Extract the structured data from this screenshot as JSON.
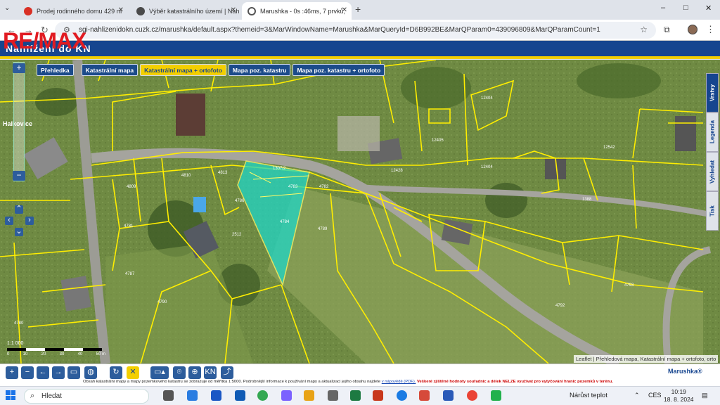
{
  "browser": {
    "tabs": [
      {
        "label": "Prodej rodinného domu 429 m",
        "favicon_color": "#d93025",
        "active": false
      },
      {
        "label": "Výběr katastrálního území | Nah",
        "favicon_color": "#4a4a4a",
        "active": false
      },
      {
        "label": "Marushka - 0s :46ms, 7 prvků,",
        "favicon_color": "#555555",
        "active": true
      }
    ],
    "url": "sgi-nahlizenidokn.cuzk.cz/marushka/default.aspx?themeid=3&MarWindowName=Marushka&MarQueryId=D6B992BE&MarQParam0=439096809&MarQParamCount=1",
    "window_controls": [
      "–",
      "□",
      "✕"
    ]
  },
  "overlay": {
    "brand": "RE/MAX"
  },
  "app": {
    "header_title": "Nahlížení do KN",
    "layers": [
      {
        "label": "Přehledka",
        "active": false
      },
      {
        "label": "Katastrální mapa",
        "active": false
      },
      {
        "label": "Katastrální mapa + ortofoto",
        "active": true
      },
      {
        "label": "Mapa poz. katastru",
        "active": false
      },
      {
        "label": "Mapa poz. katastru + ortofoto",
        "active": false
      }
    ],
    "side_tabs": [
      "Vrstvy",
      "Legenda",
      "Vyhledat",
      "Tisk"
    ],
    "map_labels": {
      "place": "Halkovice",
      "parcels": [
        "1307/2",
        "4784",
        "4789",
        "4783",
        "4782",
        "4786",
        "4781",
        "4790",
        "4792",
        "4793",
        "2512",
        "4810",
        "4809",
        "4813",
        "12404",
        "12405",
        "12404",
        "12428",
        "12542",
        "1388",
        "4787",
        "4780"
      ]
    },
    "scale": {
      "ratio": "1:1 000",
      "ticks": [
        "0",
        "10",
        "20",
        "30",
        "40",
        "50 m"
      ]
    },
    "attribution": "Leaflet | Přehledová mapa, Katastrální mapa + ortofoto, orto",
    "info": {
      "text": "Obsah katastrální mapy a mapy pozemkového katastru se zobrazuje od měřítka 1:5000. Podrobnější informace k používání mapy a aktualizaci jejího obsahu najdete",
      "link": "v nápovědě (PDF).",
      "warning": "Veškeré zjištěné hodnoty souřadnic a délek NELZE využívat pro vytyčování hranic pozemků v terénu."
    },
    "logo": "Marushka®",
    "toolbar_labels": {
      "kn": "KN"
    }
  },
  "taskbar": {
    "search": "Hledat",
    "weather": "Nárůst teplot",
    "lang": "CES",
    "time": "10:19",
    "date": "18. 8. 2024"
  },
  "colors": {
    "header": "#16458f",
    "accent_yellow": "#f3cf00",
    "parcel_lines": "#ffee00",
    "selection": "#1fd6c6"
  }
}
